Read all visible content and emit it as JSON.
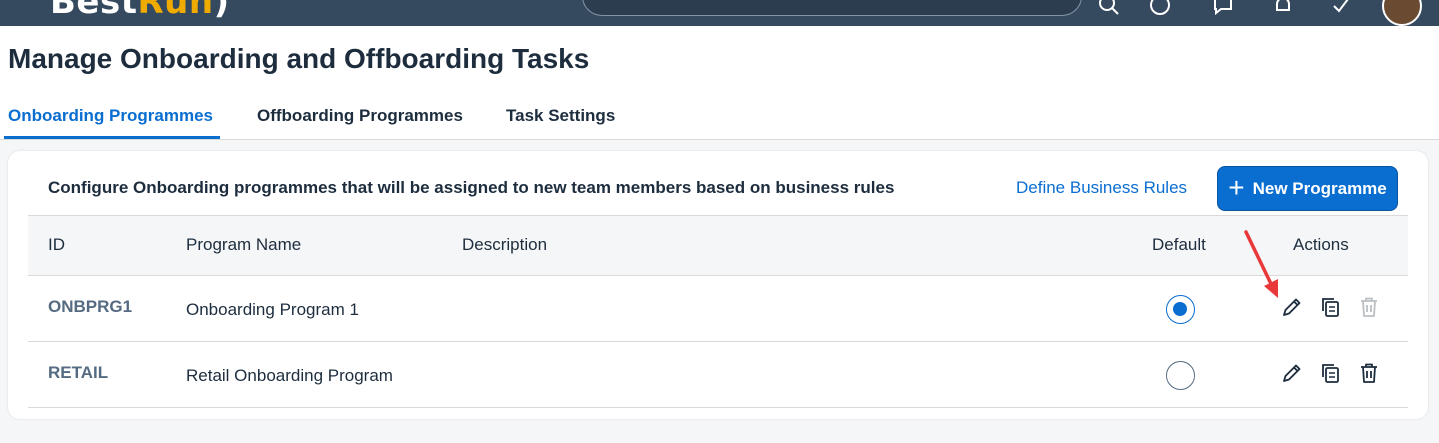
{
  "shell": {
    "logo_prefix": "Best",
    "logo_suffix": "Run",
    "logo_suffix_color": "#f0ab00",
    "icons": [
      "search-icon",
      "help-icon",
      "chat-icon",
      "notification-icon",
      "apps-icon"
    ]
  },
  "page": {
    "title": "Manage Onboarding and Offboarding Tasks"
  },
  "tabs": [
    {
      "label": "Onboarding Programmes",
      "active": true
    },
    {
      "label": "Offboarding Programmes",
      "active": false
    },
    {
      "label": "Task Settings",
      "active": false
    }
  ],
  "card": {
    "description": "Configure Onboarding programmes that will be assigned to new team members based on business rules",
    "define_rules_link": "Define Business Rules",
    "new_button_label": "New Programme",
    "new_button_icon": "plus-icon"
  },
  "table": {
    "columns": [
      "ID",
      "Program Name",
      "Description",
      "Default",
      "Actions"
    ],
    "rows": [
      {
        "id": "ONBPRG1",
        "name": "Onboarding Program 1",
        "description": "",
        "default": true,
        "delete_enabled": false
      },
      {
        "id": "RETAIL",
        "name": "Retail Onboarding Program",
        "description": "",
        "default": false,
        "delete_enabled": true
      }
    ],
    "action_icons": [
      "edit-icon",
      "copy-icon",
      "delete-icon"
    ]
  },
  "colors": {
    "accent": "#0a6ed1",
    "shell": "#354a5f",
    "annotation_arrow": "#e8383a"
  }
}
